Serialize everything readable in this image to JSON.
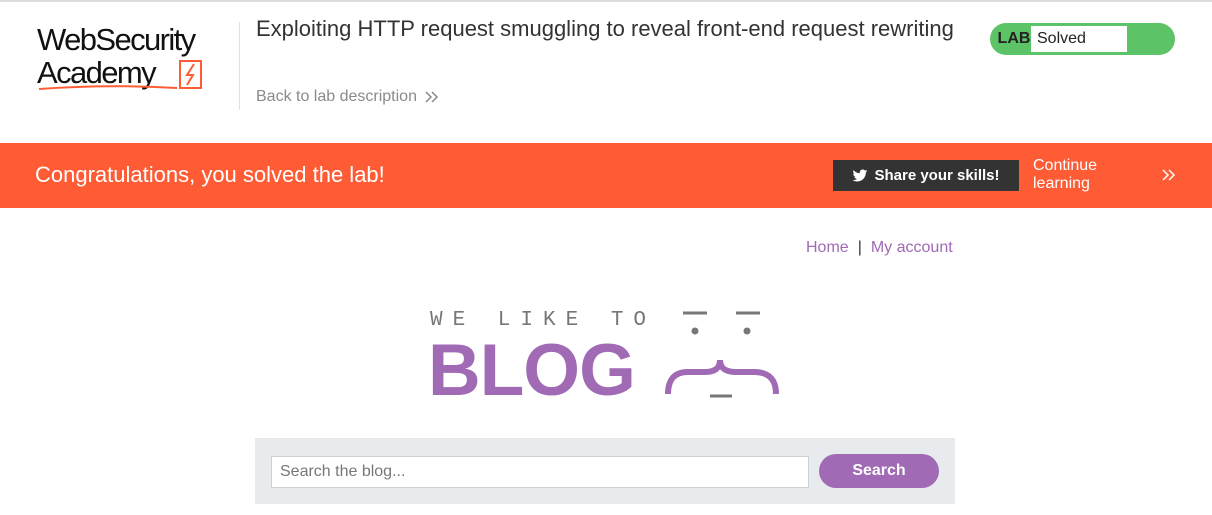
{
  "header": {
    "logo_line1": "WebSecurity",
    "logo_line2": "Academy",
    "lab_title": "Exploiting HTTP request smuggling to reveal front-end request rewriting",
    "back_link": "Back to lab description",
    "status_tag": "LAB",
    "status_text": "Solved",
    "status_color": "#5cc466"
  },
  "banner": {
    "message": "Congratulations, you solved the lab!",
    "share_label": "Share your skills!",
    "continue_label": "Continue learning",
    "color": "#ff5c35"
  },
  "nav": {
    "home": "Home",
    "separator": "|",
    "account": "My account"
  },
  "blog_logo": {
    "tagline": "WE LIKE TO",
    "word": "BLOG"
  },
  "search": {
    "placeholder": "Search the blog...",
    "value": "",
    "button": "Search"
  },
  "colors": {
    "accent": "#a06ab4"
  }
}
